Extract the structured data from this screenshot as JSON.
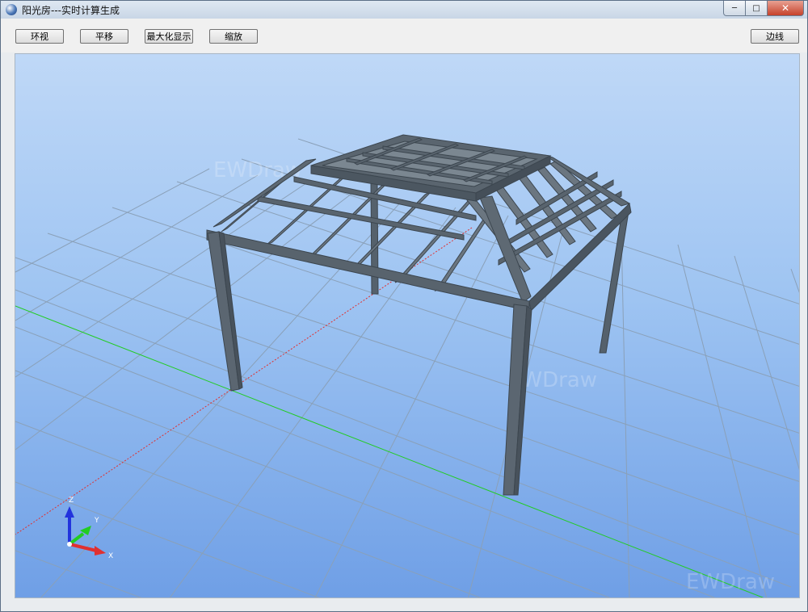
{
  "window": {
    "title": "阳光房---实时计算生成",
    "controls": [
      "minimize-icon",
      "maximize-icon",
      "close-icon"
    ]
  },
  "toolbar": {
    "orbit_label": "环视",
    "pan_label": "平移",
    "fit_label": "最大化显示",
    "zoom_label": "缩放",
    "edges_label": "边线"
  },
  "viewport": {
    "watermark": "EWDraw",
    "axes": {
      "z": "Z",
      "y": "Y",
      "x": "X"
    },
    "colors": {
      "sky_top": "#bfd8f7",
      "sky_bottom": "#6f9fe6",
      "grid": "#8aa0b8",
      "frame": "#4f5b66",
      "x_axis": "#e03030",
      "y_axis": "#22cc22",
      "z_axis": "#2233dd"
    }
  }
}
